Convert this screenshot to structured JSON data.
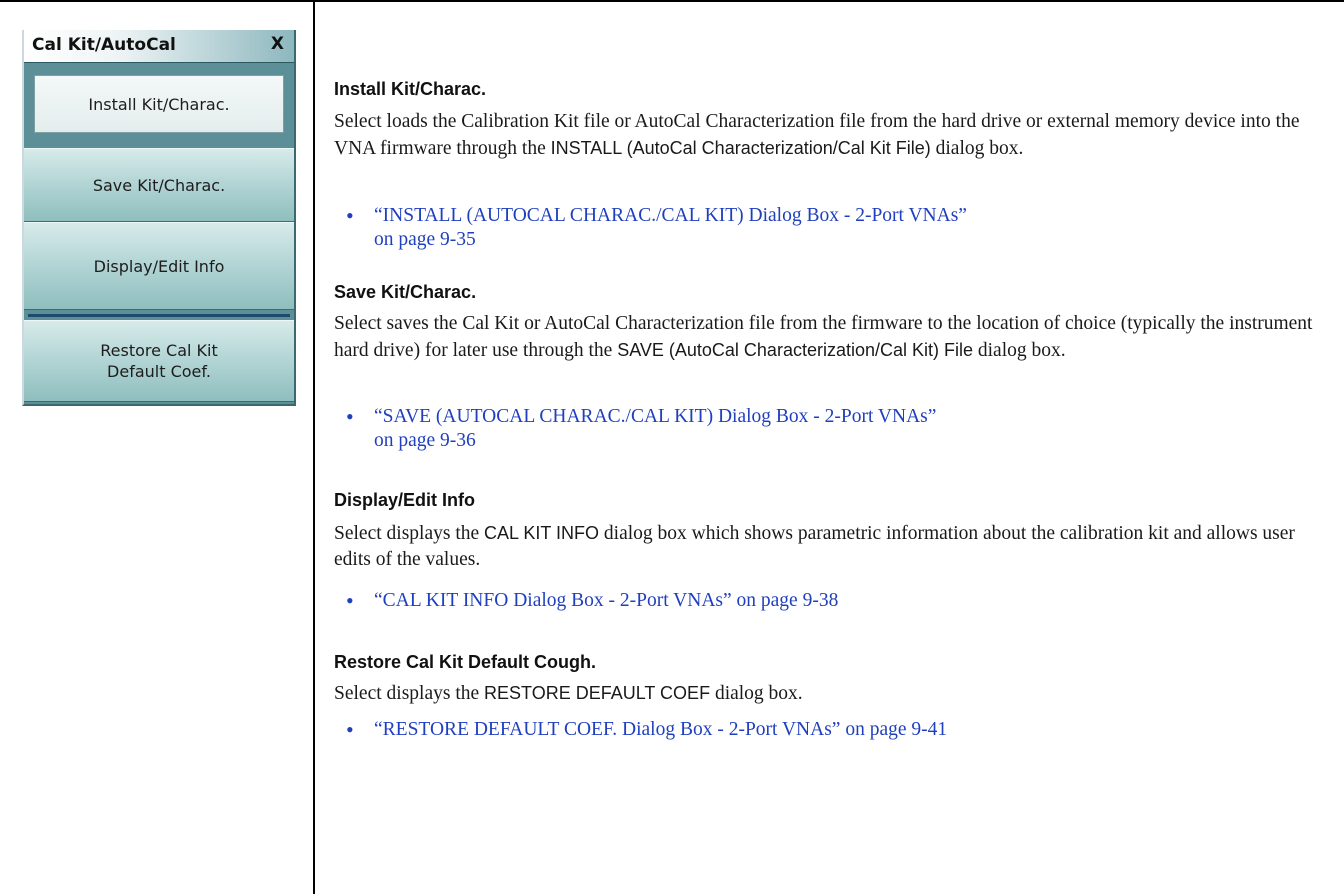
{
  "menu": {
    "title": "Cal Kit/AutoCal",
    "close": "X",
    "buttons": [
      {
        "line1": "Install Kit/Charac.",
        "line2": ""
      },
      {
        "line1": "Save Kit/Charac.",
        "line2": ""
      },
      {
        "line1": "Display/Edit Info",
        "line2": ""
      },
      {
        "line1": "Restore Cal Kit",
        "line2": "Default Coef."
      }
    ]
  },
  "sections": [
    {
      "heading": "Install Kit/Charac.",
      "text_a": "Select loads the Calibration Kit file or AutoCal Characterization file from the hard drive or external memory device into the VNA firmware through the",
      "dialog": "INSTALL (AutoCal Characterization/Cal Kit File)",
      "text_b": "dialog box.",
      "link_line1": "“INSTALL (AUTOCAL CHARAC./CAL KIT) Dialog Box - 2-Port VNAs”",
      "link_line2": "on page 9-35"
    },
    {
      "heading": "Save Kit/Charac.",
      "text_a": "Select saves the Cal Kit or AutoCal Characterization file from the firmware to the location of choice (typically the instrument hard drive) for later use through the",
      "dialog": "SAVE (AutoCal Characterization/Cal Kit) File",
      "text_b": "dialog box.",
      "link_line1": "“SAVE (AUTOCAL CHARAC./CAL KIT) Dialog Box - 2-Port VNAs”",
      "link_line2": "on page 9-36"
    },
    {
      "heading": "Display/Edit Info",
      "text_a": "Select displays the",
      "dialog": "CAL KIT INFO",
      "text_b": "dialog box which shows parametric information about the calibration kit and allows user edits of the values.",
      "link_line1": "“CAL KIT INFO Dialog Box - 2-Port VNAs” on page 9-38",
      "link_line2": ""
    },
    {
      "heading": "Restore Cal Kit Default Cough.",
      "text_a": "Select displays the",
      "dialog": "RESTORE DEFAULT COEF",
      "text_b": "dialog box.",
      "link_line1": "“RESTORE DEFAULT COEF. Dialog Box - 2-Port VNAs” on page 9-41",
      "link_line2": ""
    }
  ]
}
